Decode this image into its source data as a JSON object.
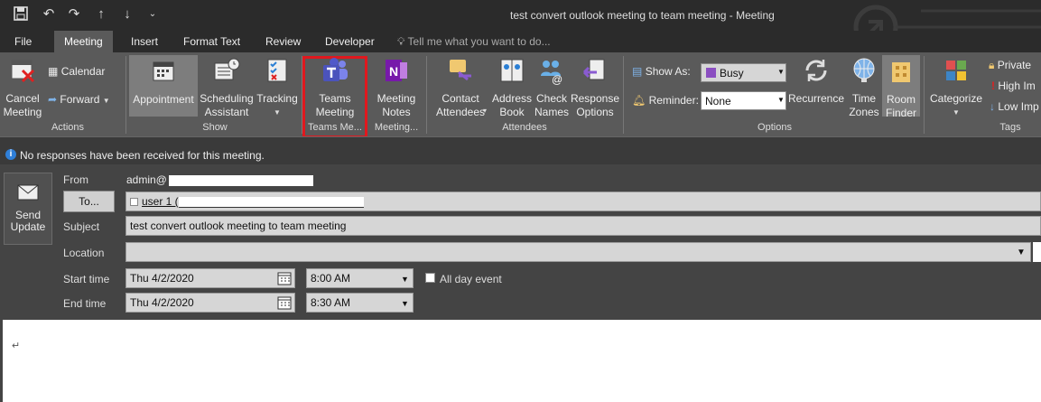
{
  "window": {
    "title": "test convert outlook meeting to team meeting - Meeting"
  },
  "tabs": [
    "File",
    "Meeting",
    "Insert",
    "Format Text",
    "Review",
    "Developer"
  ],
  "tell_me": "Tell me what you want to do...",
  "ribbon": {
    "actions": {
      "cancel": "Cancel Meeting",
      "calendar": "Calendar",
      "forward": "Forward",
      "group": "Actions"
    },
    "show": {
      "appointment": "Appointment",
      "scheduling": "Scheduling Assistant",
      "tracking": "Tracking",
      "group": "Show"
    },
    "teams": {
      "label": "Teams Meeting",
      "group": "Teams Me..."
    },
    "notes": {
      "label": "Meeting Notes",
      "group": "Meeting..."
    },
    "attendees": {
      "contact": "Contact Attendees",
      "address": "Address Book",
      "check": "Check Names",
      "response": "Response Options",
      "group": "Attendees"
    },
    "options": {
      "show_as_label": "Show As:",
      "show_as_value": "Busy",
      "reminder_label": "Reminder:",
      "reminder_value": "None",
      "recurrence": "Recurrence",
      "time_zones": "Time Zones",
      "room_finder": "Room Finder",
      "group": "Options"
    },
    "tags": {
      "categorize": "Categorize",
      "private": "Private",
      "high": "High Im",
      "low": "Low Imp",
      "group": "Tags"
    }
  },
  "info_bar": {
    "text": "No responses have been received for this meeting."
  },
  "form": {
    "send_update": "Send Update",
    "from_label": "From",
    "from_value": "admin@",
    "to_button": "To...",
    "to_value": "user 1 (",
    "subject_label": "Subject",
    "subject_value": "test convert outlook meeting to team meeting",
    "location_label": "Location",
    "location_value": "",
    "start_label": "Start time",
    "start_date": "Thu 4/2/2020",
    "start_time": "8:00 AM",
    "all_day": "All day event",
    "end_label": "End time",
    "end_date": "Thu 4/2/2020",
    "end_time": "8:30 AM"
  },
  "body": {
    "text": "↵"
  },
  "colors": {
    "highlight": "#e0181e",
    "busy": "#8b4fc1",
    "info": "#2f7fd8"
  }
}
